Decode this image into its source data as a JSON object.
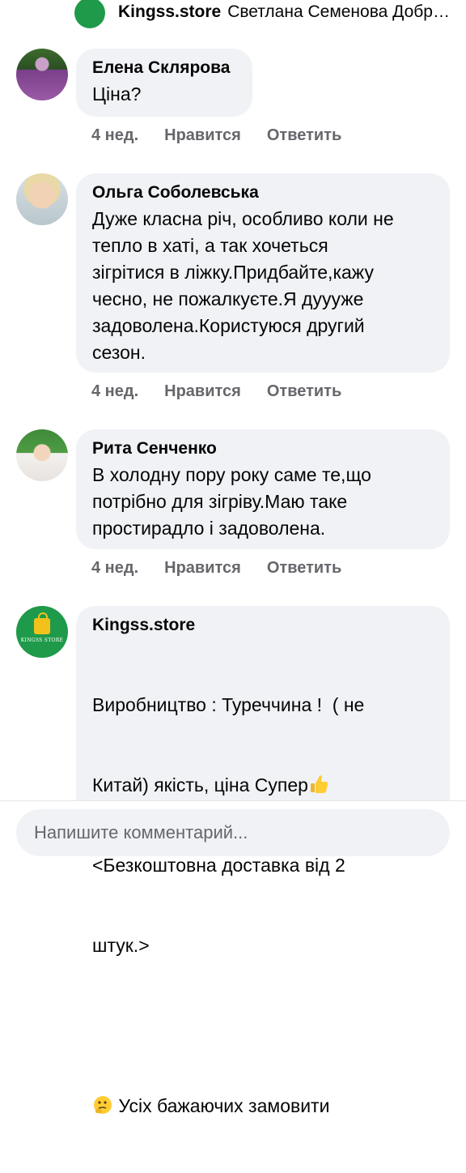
{
  "top_reply": {
    "author": "Kingss.store",
    "text": "Светлана Семенова Добро..."
  },
  "comments": [
    {
      "author": "Елена Склярова",
      "text": "Ціна?",
      "time": "4 нед.",
      "like": "Нравится",
      "reply": "Ответить"
    },
    {
      "author": "Ольга Соболевська",
      "text": "Дуже класна річ, особливо коли не\nтепло в хаті, а так хочеться\nзігрітися в ліжку.Придбайте,кажу\nчесно, не пожалкуєте.Я дуууже\nзадоволена.Користуюся другий\nсезон.",
      "time": "4 нед.",
      "like": "Нравится",
      "reply": "Ответить"
    },
    {
      "author": "Рита Сенченко",
      "text": "В холодну пору року саме те,що\nпотрібно для зігріву.Маю таке\nпростирадло і задоволена.",
      "time": "4 нед.",
      "like": "Нравится",
      "reply": "Ответить"
    },
    {
      "author": "Kingss.store",
      "text_line1": "Виробництво : Туреччина !  ( не",
      "text_line2": "Китай) якість, ціна Супер",
      "text_line3": "<Безкоштовна доставка від 2",
      "text_line4": "штук.>",
      "text_line5": "Усіх бажаючих замовити",
      "logo_text": "KINGSS STORE"
    }
  ],
  "composer": {
    "placeholder": "Напишите комментарий..."
  },
  "colors": {
    "bubble": "#f0f2f5",
    "secondary_text": "#65676b",
    "brand_green": "#1f9a4a",
    "bag_yellow": "#f2c21b"
  }
}
